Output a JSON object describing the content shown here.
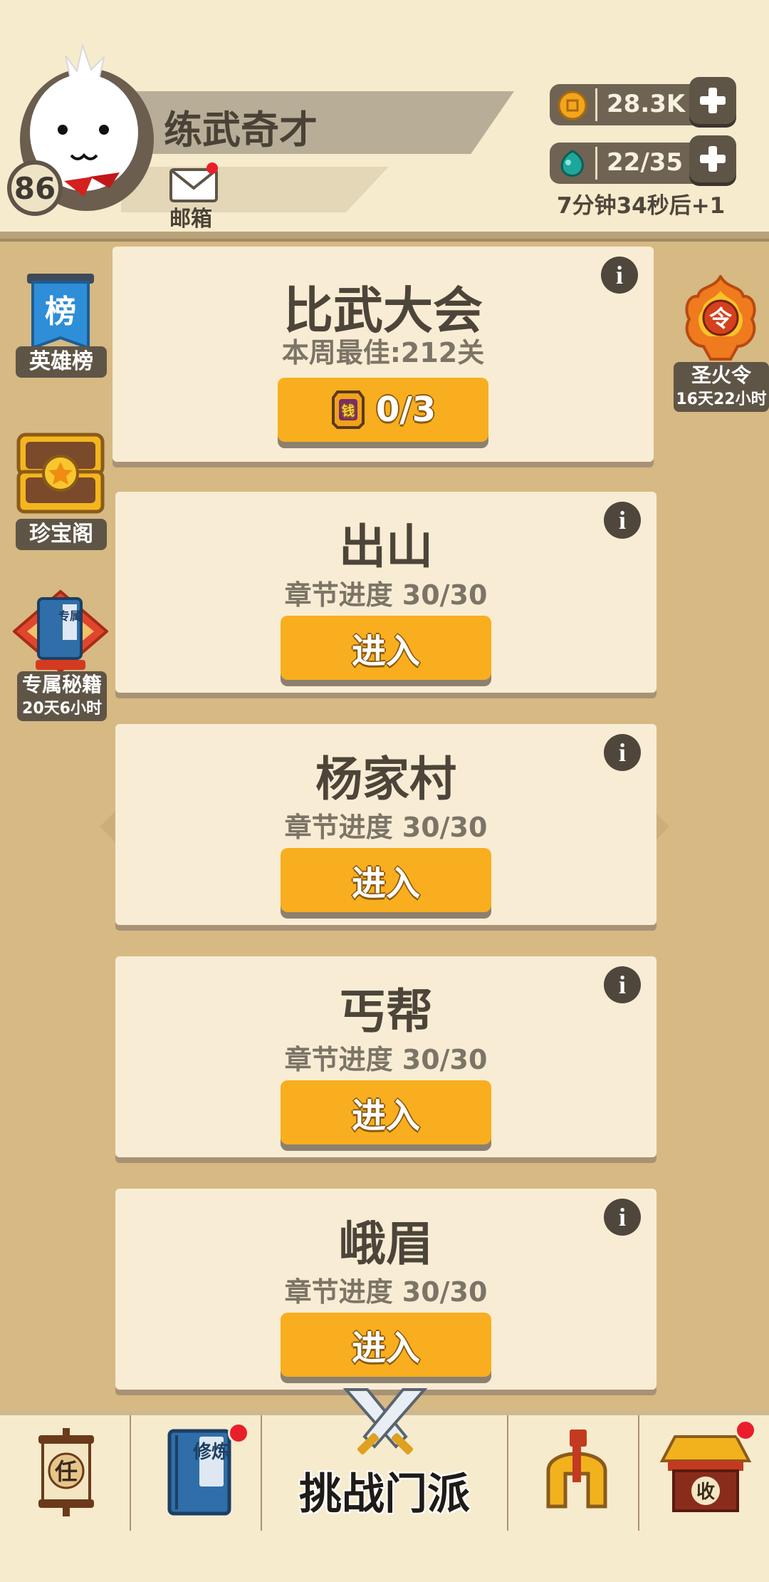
{
  "player": {
    "name": "练武奇才",
    "level": "86",
    "mail_label": "邮箱"
  },
  "resources": {
    "coins": "28.3K",
    "energy": "22/35",
    "energy_timer": "7分钟34秒后+1"
  },
  "side_left": [
    {
      "label": "英雄榜",
      "icon": "hero-ranking-banner-icon",
      "badge_char": "榜"
    },
    {
      "label": "珍宝阁",
      "icon": "treasure-chest-icon"
    },
    {
      "label": "专属秘籍",
      "sub": "20天6小时",
      "icon": "exclusive-manual-book-icon",
      "badge_char": "专属"
    }
  ],
  "side_right": {
    "label": "圣火令",
    "sub": "16天22小时",
    "icon": "sacred-flame-token-icon",
    "badge_char": "令"
  },
  "tournament": {
    "title": "比武大会",
    "best": "本周最佳:212关",
    "tickets": "0/3",
    "ticket_char": "钱"
  },
  "stages": [
    {
      "title": "出山",
      "progress": "章节进度 30/30",
      "button": "进入"
    },
    {
      "title": "杨家村",
      "progress": "章节进度 30/30",
      "button": "进入"
    },
    {
      "title": "丐帮",
      "progress": "章节进度 30/30",
      "button": "进入"
    },
    {
      "title": "峨眉",
      "progress": "章节进度 30/30",
      "button": "进入"
    }
  ],
  "info_glyph": "i",
  "bottom_nav": {
    "tasks_char": "任",
    "cultivate_chars": "修炼",
    "main_label": "挑战门派",
    "shop_char": "收"
  },
  "colors": {
    "background": "#d6b983",
    "header": "#f7ebcd",
    "card": "#f8edd4",
    "button": "#f8ae1e",
    "badge_red": "#ea1e2a"
  }
}
